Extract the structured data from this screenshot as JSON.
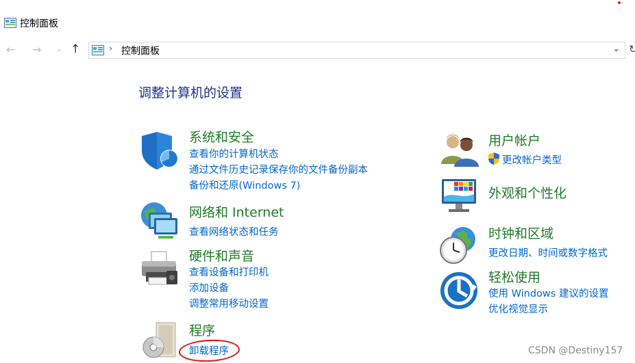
{
  "window": {
    "title": "控制面板"
  },
  "nav": {
    "back": "←",
    "forward": "→",
    "recent": "⌄",
    "up": "↑"
  },
  "address": {
    "path": "控制面板",
    "separator": "›",
    "dropdown": "⌄",
    "refresh": "↻"
  },
  "page": {
    "heading": "调整计算机的设置"
  },
  "categories": {
    "system_security": {
      "title": "系统和安全",
      "links": [
        "查看你的计算机状态",
        "通过文件历史记录保存你的文件备份副本",
        "备份和还原(Windows 7)"
      ]
    },
    "network": {
      "title": "网络和 Internet",
      "links": [
        "查看网络状态和任务"
      ]
    },
    "hardware": {
      "title": "硬件和声音",
      "links": [
        "查看设备和打印机",
        "添加设备",
        "调整常用移动设置"
      ]
    },
    "programs": {
      "title": "程序",
      "links": [
        "卸载程序"
      ]
    },
    "user_accounts": {
      "title": "用户帐户",
      "links": [
        "更改帐户类型"
      ]
    },
    "appearance": {
      "title": "外观和个性化",
      "links": []
    },
    "clock_region": {
      "title": "时钟和区域",
      "links": [
        "更改日期、时间或数字格式"
      ]
    },
    "ease_of_access": {
      "title": "轻松使用",
      "links": [
        "使用 Windows 建议的设置",
        "优化视觉显示"
      ]
    }
  },
  "watermark": "CSDN @Destiny157",
  "colors": {
    "category_green": "#1f7a28",
    "link_blue": "#0066cc",
    "heading_blue": "#1e3287",
    "annotation_red": "#e0101a"
  }
}
